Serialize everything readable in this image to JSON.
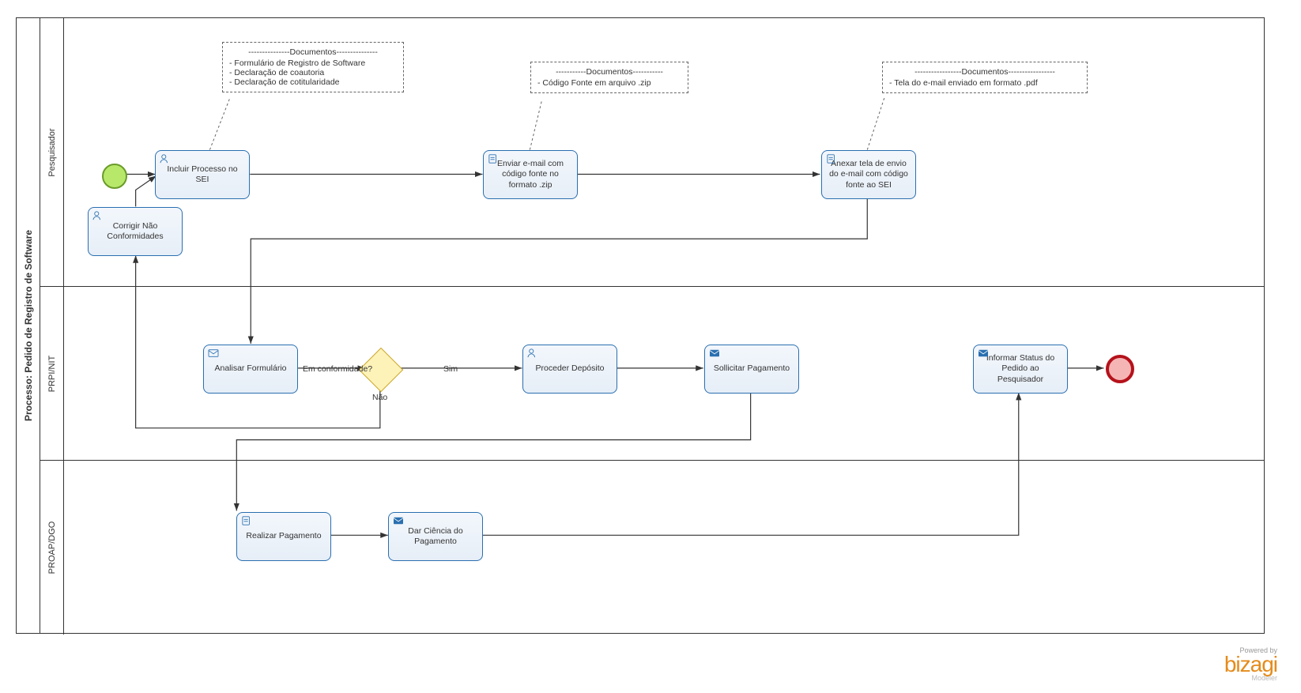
{
  "pool": {
    "title": "Processo: Pedido de Registro de Software"
  },
  "lanes": {
    "l1": "Pesquisador",
    "l2": "PRPI/NIT",
    "l3": "PROAP/DGO"
  },
  "tasks": {
    "incluir": "Incluir Processo no SEI",
    "enviar": "Enviar e-mail com código fonte no formato .zip",
    "anexar": "Anexar tela de envio do e-mail com código fonte ao SEI",
    "corrigir": "Corrigir Não Conformidades",
    "analisar": "Analisar Formulário",
    "proceder": "Proceder Depósito",
    "solicitar": "Sollicitar Pagamento",
    "informar": "Informar Status do Pedido ao Pesquisador",
    "realizar": "Realizar Pagamento",
    "ciencia": "Dar Ciência do Pagamento"
  },
  "gateway": {
    "question": "Em conformidade?",
    "yes": "Sim",
    "no": "Não"
  },
  "annotations": {
    "a1": {
      "header": "---------------Documentos---------------",
      "l1": "- Formulário de Registro de Software",
      "l2": "- Declaração de coautoria",
      "l3": "- Declaração de cotitularidade"
    },
    "a2": {
      "header": "-----------Documentos-----------",
      "l1": "- Código Fonte em arquivo .zip"
    },
    "a3": {
      "header": "-----------------Documentos-----------------",
      "l1": "- Tela do e-mail enviado em formato .pdf"
    }
  },
  "brand": {
    "powered": "Powered by",
    "name": "bizagi",
    "sub": "Modeler"
  }
}
